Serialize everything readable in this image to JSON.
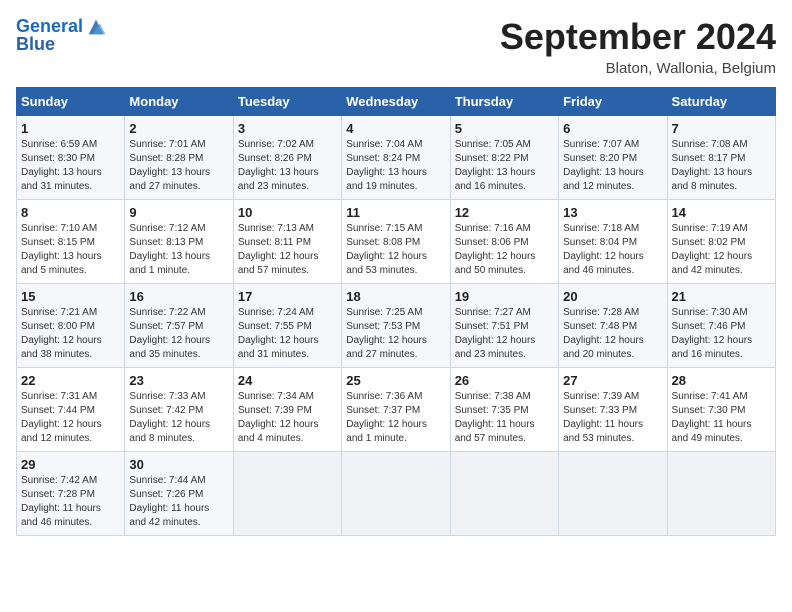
{
  "header": {
    "logo_line1": "General",
    "logo_line2": "Blue",
    "month": "September 2024",
    "location": "Blaton, Wallonia, Belgium"
  },
  "days_of_week": [
    "Sunday",
    "Monday",
    "Tuesday",
    "Wednesday",
    "Thursday",
    "Friday",
    "Saturday"
  ],
  "weeks": [
    [
      {
        "day": "1",
        "info": "Sunrise: 6:59 AM\nSunset: 8:30 PM\nDaylight: 13 hours\nand 31 minutes."
      },
      {
        "day": "2",
        "info": "Sunrise: 7:01 AM\nSunset: 8:28 PM\nDaylight: 13 hours\nand 27 minutes."
      },
      {
        "day": "3",
        "info": "Sunrise: 7:02 AM\nSunset: 8:26 PM\nDaylight: 13 hours\nand 23 minutes."
      },
      {
        "day": "4",
        "info": "Sunrise: 7:04 AM\nSunset: 8:24 PM\nDaylight: 13 hours\nand 19 minutes."
      },
      {
        "day": "5",
        "info": "Sunrise: 7:05 AM\nSunset: 8:22 PM\nDaylight: 13 hours\nand 16 minutes."
      },
      {
        "day": "6",
        "info": "Sunrise: 7:07 AM\nSunset: 8:20 PM\nDaylight: 13 hours\nand 12 minutes."
      },
      {
        "day": "7",
        "info": "Sunrise: 7:08 AM\nSunset: 8:17 PM\nDaylight: 13 hours\nand 8 minutes."
      }
    ],
    [
      {
        "day": "8",
        "info": "Sunrise: 7:10 AM\nSunset: 8:15 PM\nDaylight: 13 hours\nand 5 minutes."
      },
      {
        "day": "9",
        "info": "Sunrise: 7:12 AM\nSunset: 8:13 PM\nDaylight: 13 hours\nand 1 minute."
      },
      {
        "day": "10",
        "info": "Sunrise: 7:13 AM\nSunset: 8:11 PM\nDaylight: 12 hours\nand 57 minutes."
      },
      {
        "day": "11",
        "info": "Sunrise: 7:15 AM\nSunset: 8:08 PM\nDaylight: 12 hours\nand 53 minutes."
      },
      {
        "day": "12",
        "info": "Sunrise: 7:16 AM\nSunset: 8:06 PM\nDaylight: 12 hours\nand 50 minutes."
      },
      {
        "day": "13",
        "info": "Sunrise: 7:18 AM\nSunset: 8:04 PM\nDaylight: 12 hours\nand 46 minutes."
      },
      {
        "day": "14",
        "info": "Sunrise: 7:19 AM\nSunset: 8:02 PM\nDaylight: 12 hours\nand 42 minutes."
      }
    ],
    [
      {
        "day": "15",
        "info": "Sunrise: 7:21 AM\nSunset: 8:00 PM\nDaylight: 12 hours\nand 38 minutes."
      },
      {
        "day": "16",
        "info": "Sunrise: 7:22 AM\nSunset: 7:57 PM\nDaylight: 12 hours\nand 35 minutes."
      },
      {
        "day": "17",
        "info": "Sunrise: 7:24 AM\nSunset: 7:55 PM\nDaylight: 12 hours\nand 31 minutes."
      },
      {
        "day": "18",
        "info": "Sunrise: 7:25 AM\nSunset: 7:53 PM\nDaylight: 12 hours\nand 27 minutes."
      },
      {
        "day": "19",
        "info": "Sunrise: 7:27 AM\nSunset: 7:51 PM\nDaylight: 12 hours\nand 23 minutes."
      },
      {
        "day": "20",
        "info": "Sunrise: 7:28 AM\nSunset: 7:48 PM\nDaylight: 12 hours\nand 20 minutes."
      },
      {
        "day": "21",
        "info": "Sunrise: 7:30 AM\nSunset: 7:46 PM\nDaylight: 12 hours\nand 16 minutes."
      }
    ],
    [
      {
        "day": "22",
        "info": "Sunrise: 7:31 AM\nSunset: 7:44 PM\nDaylight: 12 hours\nand 12 minutes."
      },
      {
        "day": "23",
        "info": "Sunrise: 7:33 AM\nSunset: 7:42 PM\nDaylight: 12 hours\nand 8 minutes."
      },
      {
        "day": "24",
        "info": "Sunrise: 7:34 AM\nSunset: 7:39 PM\nDaylight: 12 hours\nand 4 minutes."
      },
      {
        "day": "25",
        "info": "Sunrise: 7:36 AM\nSunset: 7:37 PM\nDaylight: 12 hours\nand 1 minute."
      },
      {
        "day": "26",
        "info": "Sunrise: 7:38 AM\nSunset: 7:35 PM\nDaylight: 11 hours\nand 57 minutes."
      },
      {
        "day": "27",
        "info": "Sunrise: 7:39 AM\nSunset: 7:33 PM\nDaylight: 11 hours\nand 53 minutes."
      },
      {
        "day": "28",
        "info": "Sunrise: 7:41 AM\nSunset: 7:30 PM\nDaylight: 11 hours\nand 49 minutes."
      }
    ],
    [
      {
        "day": "29",
        "info": "Sunrise: 7:42 AM\nSunset: 7:28 PM\nDaylight: 11 hours\nand 46 minutes."
      },
      {
        "day": "30",
        "info": "Sunrise: 7:44 AM\nSunset: 7:26 PM\nDaylight: 11 hours\nand 42 minutes."
      },
      {
        "day": "",
        "info": ""
      },
      {
        "day": "",
        "info": ""
      },
      {
        "day": "",
        "info": ""
      },
      {
        "day": "",
        "info": ""
      },
      {
        "day": "",
        "info": ""
      }
    ]
  ]
}
